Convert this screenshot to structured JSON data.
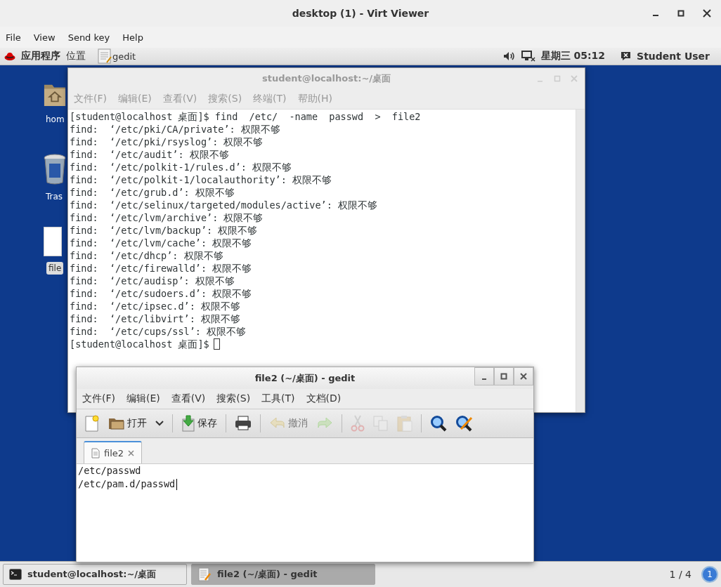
{
  "viewer": {
    "title": "desktop (1) - Virt Viewer",
    "menu": [
      "File",
      "View",
      "Send key",
      "Help"
    ]
  },
  "top_bar": {
    "applications": "应用程序",
    "places": "位置",
    "app": "gedit",
    "clock": "星期三 05:12",
    "user": "Student User"
  },
  "desktop_icons": [
    {
      "kind": "home",
      "label": "hom"
    },
    {
      "kind": "trash",
      "label": "Tras"
    },
    {
      "kind": "file",
      "label": "file"
    }
  ],
  "terminal": {
    "title": "student@localhost:~/桌面",
    "menu": [
      "文件(F)",
      "编辑(E)",
      "查看(V)",
      "搜索(S)",
      "终端(T)",
      "帮助(H)"
    ],
    "lines": [
      "[student@localhost 桌面]$ find  /etc/  -name  passwd  >  file2",
      "find:  ‘/etc/pki/CA/private’: 权限不够",
      "find:  ‘/etc/pki/rsyslog’: 权限不够",
      "find:  ‘/etc/audit’: 权限不够",
      "find:  ‘/etc/polkit-1/rules.d’: 权限不够",
      "find:  ‘/etc/polkit-1/localauthority’: 权限不够",
      "find:  ‘/etc/grub.d’: 权限不够",
      "find:  ‘/etc/selinux/targeted/modules/active’: 权限不够",
      "find:  ‘/etc/lvm/archive’: 权限不够",
      "find:  ‘/etc/lvm/backup’: 权限不够",
      "find:  ‘/etc/lvm/cache’: 权限不够",
      "find:  ‘/etc/dhcp’: 权限不够",
      "find:  ‘/etc/firewalld’: 权限不够",
      "find:  ‘/etc/audisp’: 权限不够",
      "find:  ‘/etc/sudoers.d’: 权限不够",
      "find:  ‘/etc/ipsec.d’: 权限不够",
      "find:  ‘/etc/libvirt’: 权限不够",
      "find:  ‘/etc/cups/ssl’: 权限不够"
    ],
    "prompt": "[student@localhost 桌面]$"
  },
  "gedit": {
    "title": "file2 (~/桌面) - gedit",
    "menu": [
      "文件(F)",
      "编辑(E)",
      "查看(V)",
      "搜索(S)",
      "工具(T)",
      "文档(D)"
    ],
    "toolbar": [
      {
        "kind": "new",
        "disabled": false
      },
      {
        "kind": "open",
        "label": "打开",
        "disabled": false
      },
      {
        "kind": "dropdown",
        "disabled": false
      },
      {
        "kind": "sep"
      },
      {
        "kind": "save",
        "label": "保存",
        "disabled": false
      },
      {
        "kind": "sep"
      },
      {
        "kind": "print",
        "disabled": false
      },
      {
        "kind": "sep"
      },
      {
        "kind": "undo",
        "label": "撤消",
        "disabled": true
      },
      {
        "kind": "redo",
        "disabled": true
      },
      {
        "kind": "sep"
      },
      {
        "kind": "cut",
        "disabled": true
      },
      {
        "kind": "copy",
        "disabled": true
      },
      {
        "kind": "paste",
        "disabled": true
      },
      {
        "kind": "sep"
      },
      {
        "kind": "find",
        "disabled": false
      },
      {
        "kind": "replace",
        "disabled": false
      }
    ],
    "tabs": [
      {
        "label": "file2",
        "selected": true
      }
    ],
    "lines": [
      "/etc/passwd",
      "/etc/pam.d/passwd"
    ]
  },
  "taskbar": {
    "tasks": [
      {
        "kind": "terminal",
        "label": "student@localhost:~/桌面",
        "selected": false
      },
      {
        "kind": "editor",
        "label": "file2 (~/桌面) - gedit",
        "selected": true
      }
    ],
    "workspace": "1 / 4",
    "badge": "1"
  }
}
